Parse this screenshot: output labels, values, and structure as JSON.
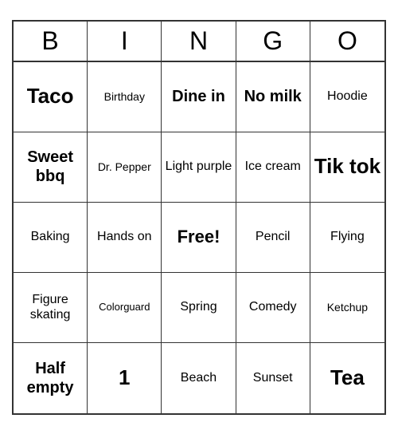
{
  "header": {
    "letters": [
      "B",
      "I",
      "N",
      "G",
      "O"
    ]
  },
  "cells": [
    {
      "text": "Taco",
      "size": "xl"
    },
    {
      "text": "Birthday",
      "size": "sm"
    },
    {
      "text": "Dine in",
      "size": "lg"
    },
    {
      "text": "No milk",
      "size": "lg"
    },
    {
      "text": "Hoodie",
      "size": "md"
    },
    {
      "text": "Sweet bbq",
      "size": "lg"
    },
    {
      "text": "Dr. Pepper",
      "size": "sm"
    },
    {
      "text": "Light purple",
      "size": "md"
    },
    {
      "text": "Ice cream",
      "size": "md"
    },
    {
      "text": "Tik tok",
      "size": "xl"
    },
    {
      "text": "Baking",
      "size": "md"
    },
    {
      "text": "Hands on",
      "size": "md"
    },
    {
      "text": "Free!",
      "size": "free"
    },
    {
      "text": "Pencil",
      "size": "md"
    },
    {
      "text": "Flying",
      "size": "md"
    },
    {
      "text": "Figure skating",
      "size": "md"
    },
    {
      "text": "Colorguard",
      "size": "xs"
    },
    {
      "text": "Spring",
      "size": "md"
    },
    {
      "text": "Comedy",
      "size": "md"
    },
    {
      "text": "Ketchup",
      "size": "sm"
    },
    {
      "text": "Half empty",
      "size": "lg"
    },
    {
      "text": "1",
      "size": "xl"
    },
    {
      "text": "Beach",
      "size": "md"
    },
    {
      "text": "Sunset",
      "size": "md"
    },
    {
      "text": "Tea",
      "size": "xl"
    }
  ]
}
